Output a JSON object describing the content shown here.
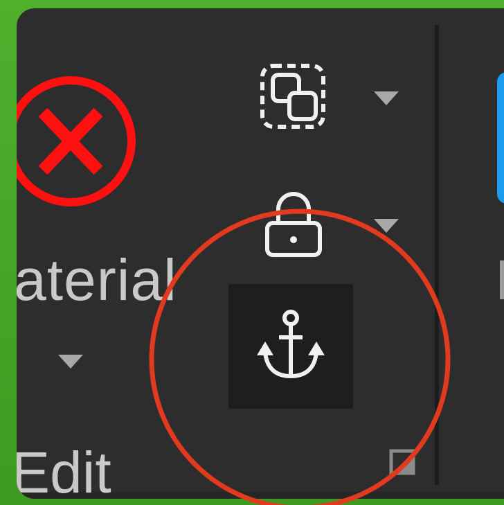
{
  "ribbon": {
    "material_label": "aterial",
    "edit_label": "Edit"
  },
  "icons": {
    "remove": "remove-x-icon",
    "select": "selection-mode-icon",
    "lock": "lock-icon",
    "anchor": "anchor-icon",
    "dropdown": "dropdown-arrow-icon",
    "dialog_launcher": "dialog-launcher-icon"
  },
  "colors": {
    "panel": "#2d2d2d",
    "background": "#4aa82a",
    "accent": "#1a9df0",
    "remove_icon": "#ff1010",
    "highlight": "#e23a1e",
    "anchor_button_bg": "#1e1e1e",
    "text": "#c9c9c9"
  }
}
